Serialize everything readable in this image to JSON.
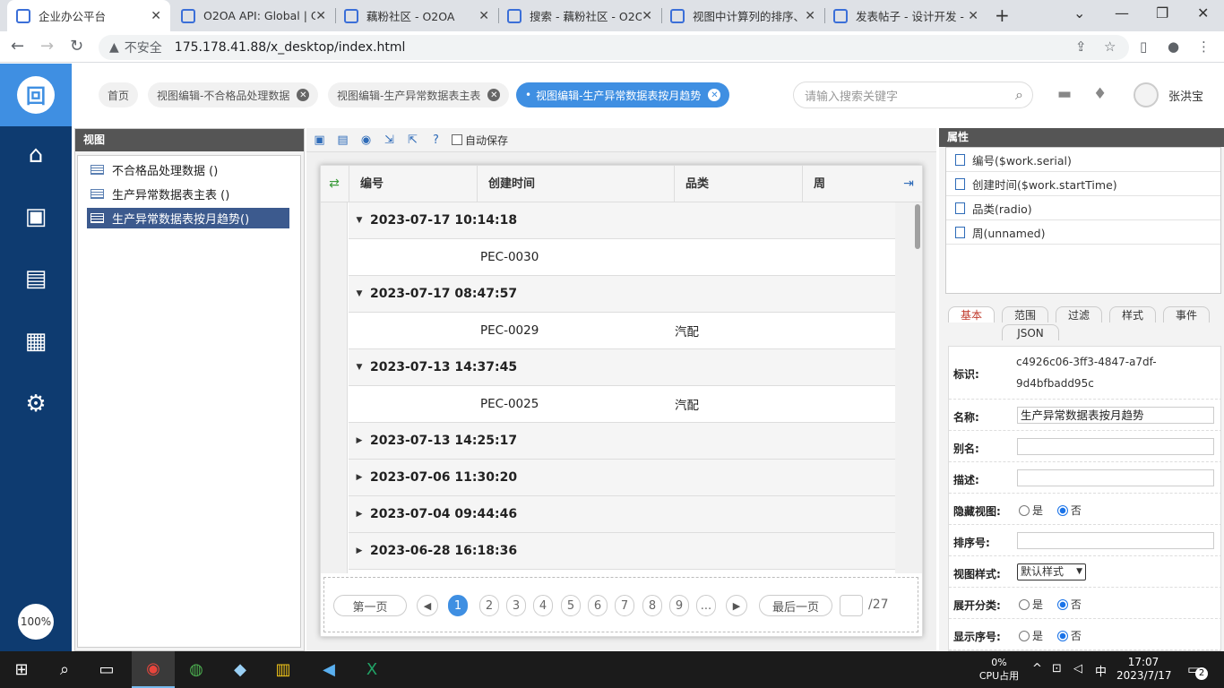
{
  "browser": {
    "tabs": [
      {
        "label": "企业办公平台",
        "active": true
      },
      {
        "label": "O2OA API: Global | C",
        "active": false
      },
      {
        "label": "藕粉社区 - O2OA",
        "active": false
      },
      {
        "label": "搜索 - 藕粉社区 - O2O",
        "active": false
      },
      {
        "label": "视图中计算列的排序、",
        "active": false
      },
      {
        "label": "发表帖子 - 设计开发 -",
        "active": false
      }
    ],
    "new_tab": "+",
    "security_label": "不安全",
    "url": "175.178.41.88/x_desktop/index.html"
  },
  "nav": {
    "zoom": "100%",
    "icons": [
      "home-icon",
      "meeting-icon",
      "news-icon",
      "calendar-icon",
      "user-settings-icon"
    ]
  },
  "breadcrumbs": [
    {
      "label": "首页",
      "closable": false,
      "active": false
    },
    {
      "label": "视图编辑-不合格品处理数据",
      "closable": true,
      "active": false
    },
    {
      "label": "视图编辑-生产异常数据表主表",
      "closable": true,
      "active": false
    },
    {
      "label": "视图编辑-生产异常数据表按月趋势",
      "closable": true,
      "active": true
    }
  ],
  "search": {
    "placeholder": "请输入搜索关键字"
  },
  "user": {
    "name": "张洪宝"
  },
  "view_panel": {
    "title": "视图",
    "items": [
      {
        "label": "不合格品处理数据 ()",
        "selected": false
      },
      {
        "label": "生产异常数据表主表 ()",
        "selected": false
      },
      {
        "label": "生产异常数据表按月趋势()",
        "selected": true
      }
    ]
  },
  "editor": {
    "autosave_label": "自动保存",
    "columns": [
      "编号",
      "创建时间",
      "品类",
      "周"
    ],
    "rows": [
      {
        "type": "group",
        "label": "2023-07-17 10:14:18",
        "expanded": true
      },
      {
        "type": "data",
        "serial": "PEC-0030",
        "category": ""
      },
      {
        "type": "group",
        "label": "2023-07-17 08:47:57",
        "expanded": true
      },
      {
        "type": "data",
        "serial": "PEC-0029",
        "category": "汽配"
      },
      {
        "type": "group",
        "label": "2023-07-13 14:37:45",
        "expanded": true
      },
      {
        "type": "data",
        "serial": "PEC-0025",
        "category": "汽配"
      },
      {
        "type": "group",
        "label": "2023-07-13 14:25:17",
        "expanded": false
      },
      {
        "type": "group",
        "label": "2023-07-06 11:30:20",
        "expanded": false
      },
      {
        "type": "group",
        "label": "2023-07-04 09:44:46",
        "expanded": false
      },
      {
        "type": "group",
        "label": "2023-06-28 16:18:36",
        "expanded": false
      }
    ],
    "pager": {
      "first": "第一页",
      "last": "最后一页",
      "pages": [
        "1",
        "2",
        "3",
        "4",
        "5",
        "6",
        "7",
        "8",
        "9",
        "..."
      ],
      "current": "1",
      "total": "/27"
    }
  },
  "props": {
    "title": "属性",
    "fields": [
      "编号($work.serial)",
      "创建时间($work.startTime)",
      "品类(radio)",
      "周(unnamed)"
    ],
    "tabs": [
      "基本",
      "范围",
      "过滤",
      "样式",
      "事件",
      "JSON"
    ],
    "form": {
      "id_label": "标识:",
      "id_value_1": "c4926c06-3ff3-4847-a7df-",
      "id_value_2": "9d4bfbadd95c",
      "name_label": "名称:",
      "name_value": "生产异常数据表按月趋势",
      "alias_label": "别名:",
      "desc_label": "描述:",
      "hide_label": "隐藏视图:",
      "yes": "是",
      "no": "否",
      "order_label": "排序号:",
      "style_label": "视图样式:",
      "style_value": "默认样式",
      "expand_label": "展开分类:",
      "show_label": "显示序号:"
    }
  },
  "taskbar": {
    "cpu_percent": "0%",
    "cpu_label": "CPU占用",
    "ime": "中",
    "time": "17:07",
    "date": "2023/7/17",
    "notifications": "2"
  },
  "colors": {
    "nav_bg": "#0e3b70",
    "accent": "#3f8fe2",
    "selected": "#3c5a8e"
  }
}
